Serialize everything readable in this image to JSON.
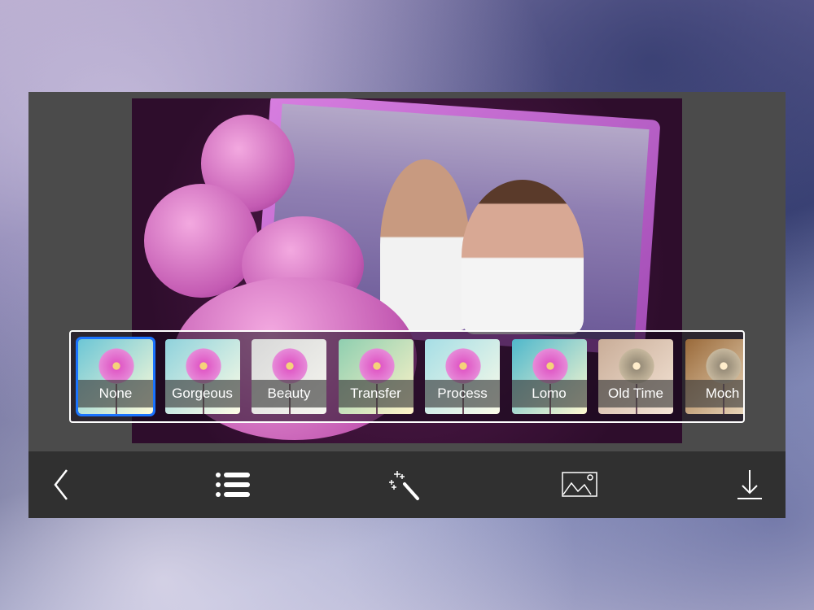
{
  "filters": [
    {
      "label": "None",
      "selected": true,
      "tint": "linear-gradient(135deg,#6cc6d6,#fffbd8)"
    },
    {
      "label": "Gorgeous",
      "selected": false,
      "tint": "linear-gradient(135deg,#8fd2dc,#fffde6)"
    },
    {
      "label": "Beauty",
      "selected": false,
      "tint": "linear-gradient(135deg,#d8d8d8,#f6f6f0)"
    },
    {
      "label": "Transfer",
      "selected": false,
      "tint": "linear-gradient(135deg,#8fcfb0,#fff3c8)"
    },
    {
      "label": "Process",
      "selected": false,
      "tint": "linear-gradient(135deg,#a6dee6,#fbfbe8)"
    },
    {
      "label": "Lomo",
      "selected": false,
      "tint": "linear-gradient(135deg,#4fb8cc,#fff8d0)"
    },
    {
      "label": "Old Time",
      "selected": false,
      "tint": "linear-gradient(135deg,#c9ad98,#f4e4d6)"
    },
    {
      "label": "Moch",
      "selected": false,
      "tint": "linear-gradient(135deg,#9a6a3a,#f2e2c8)"
    }
  ],
  "toolbar": {
    "icons": [
      "back-icon",
      "list-icon",
      "magic-wand-icon",
      "image-icon",
      "download-icon"
    ]
  }
}
